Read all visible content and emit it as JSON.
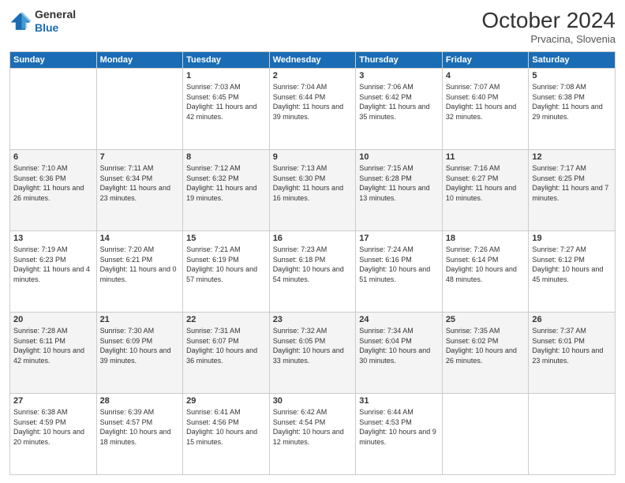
{
  "header": {
    "logo_general": "General",
    "logo_blue": "Blue",
    "month": "October 2024",
    "location": "Prvacina, Slovenia"
  },
  "days_of_week": [
    "Sunday",
    "Monday",
    "Tuesday",
    "Wednesday",
    "Thursday",
    "Friday",
    "Saturday"
  ],
  "weeks": [
    [
      {
        "day": "",
        "info": ""
      },
      {
        "day": "",
        "info": ""
      },
      {
        "day": "1",
        "info": "Sunrise: 7:03 AM\nSunset: 6:45 PM\nDaylight: 11 hours and 42 minutes."
      },
      {
        "day": "2",
        "info": "Sunrise: 7:04 AM\nSunset: 6:44 PM\nDaylight: 11 hours and 39 minutes."
      },
      {
        "day": "3",
        "info": "Sunrise: 7:06 AM\nSunset: 6:42 PM\nDaylight: 11 hours and 35 minutes."
      },
      {
        "day": "4",
        "info": "Sunrise: 7:07 AM\nSunset: 6:40 PM\nDaylight: 11 hours and 32 minutes."
      },
      {
        "day": "5",
        "info": "Sunrise: 7:08 AM\nSunset: 6:38 PM\nDaylight: 11 hours and 29 minutes."
      }
    ],
    [
      {
        "day": "6",
        "info": "Sunrise: 7:10 AM\nSunset: 6:36 PM\nDaylight: 11 hours and 26 minutes."
      },
      {
        "day": "7",
        "info": "Sunrise: 7:11 AM\nSunset: 6:34 PM\nDaylight: 11 hours and 23 minutes."
      },
      {
        "day": "8",
        "info": "Sunrise: 7:12 AM\nSunset: 6:32 PM\nDaylight: 11 hours and 19 minutes."
      },
      {
        "day": "9",
        "info": "Sunrise: 7:13 AM\nSunset: 6:30 PM\nDaylight: 11 hours and 16 minutes."
      },
      {
        "day": "10",
        "info": "Sunrise: 7:15 AM\nSunset: 6:28 PM\nDaylight: 11 hours and 13 minutes."
      },
      {
        "day": "11",
        "info": "Sunrise: 7:16 AM\nSunset: 6:27 PM\nDaylight: 11 hours and 10 minutes."
      },
      {
        "day": "12",
        "info": "Sunrise: 7:17 AM\nSunset: 6:25 PM\nDaylight: 11 hours and 7 minutes."
      }
    ],
    [
      {
        "day": "13",
        "info": "Sunrise: 7:19 AM\nSunset: 6:23 PM\nDaylight: 11 hours and 4 minutes."
      },
      {
        "day": "14",
        "info": "Sunrise: 7:20 AM\nSunset: 6:21 PM\nDaylight: 11 hours and 0 minutes."
      },
      {
        "day": "15",
        "info": "Sunrise: 7:21 AM\nSunset: 6:19 PM\nDaylight: 10 hours and 57 minutes."
      },
      {
        "day": "16",
        "info": "Sunrise: 7:23 AM\nSunset: 6:18 PM\nDaylight: 10 hours and 54 minutes."
      },
      {
        "day": "17",
        "info": "Sunrise: 7:24 AM\nSunset: 6:16 PM\nDaylight: 10 hours and 51 minutes."
      },
      {
        "day": "18",
        "info": "Sunrise: 7:26 AM\nSunset: 6:14 PM\nDaylight: 10 hours and 48 minutes."
      },
      {
        "day": "19",
        "info": "Sunrise: 7:27 AM\nSunset: 6:12 PM\nDaylight: 10 hours and 45 minutes."
      }
    ],
    [
      {
        "day": "20",
        "info": "Sunrise: 7:28 AM\nSunset: 6:11 PM\nDaylight: 10 hours and 42 minutes."
      },
      {
        "day": "21",
        "info": "Sunrise: 7:30 AM\nSunset: 6:09 PM\nDaylight: 10 hours and 39 minutes."
      },
      {
        "day": "22",
        "info": "Sunrise: 7:31 AM\nSunset: 6:07 PM\nDaylight: 10 hours and 36 minutes."
      },
      {
        "day": "23",
        "info": "Sunrise: 7:32 AM\nSunset: 6:05 PM\nDaylight: 10 hours and 33 minutes."
      },
      {
        "day": "24",
        "info": "Sunrise: 7:34 AM\nSunset: 6:04 PM\nDaylight: 10 hours and 30 minutes."
      },
      {
        "day": "25",
        "info": "Sunrise: 7:35 AM\nSunset: 6:02 PM\nDaylight: 10 hours and 26 minutes."
      },
      {
        "day": "26",
        "info": "Sunrise: 7:37 AM\nSunset: 6:01 PM\nDaylight: 10 hours and 23 minutes."
      }
    ],
    [
      {
        "day": "27",
        "info": "Sunrise: 6:38 AM\nSunset: 4:59 PM\nDaylight: 10 hours and 20 minutes."
      },
      {
        "day": "28",
        "info": "Sunrise: 6:39 AM\nSunset: 4:57 PM\nDaylight: 10 hours and 18 minutes."
      },
      {
        "day": "29",
        "info": "Sunrise: 6:41 AM\nSunset: 4:56 PM\nDaylight: 10 hours and 15 minutes."
      },
      {
        "day": "30",
        "info": "Sunrise: 6:42 AM\nSunset: 4:54 PM\nDaylight: 10 hours and 12 minutes."
      },
      {
        "day": "31",
        "info": "Sunrise: 6:44 AM\nSunset: 4:53 PM\nDaylight: 10 hours and 9 minutes."
      },
      {
        "day": "",
        "info": ""
      },
      {
        "day": "",
        "info": ""
      }
    ]
  ]
}
